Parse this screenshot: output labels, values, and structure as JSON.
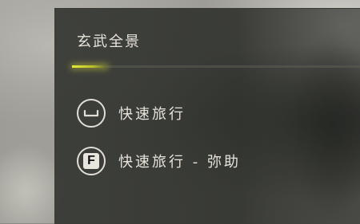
{
  "panel": {
    "title": "玄武全景",
    "progress": 0.12
  },
  "actions": [
    {
      "key": "space",
      "key_label": "",
      "label": "快速旅行"
    },
    {
      "key": "F",
      "key_label": "F",
      "label": "快速旅行 - 弥助"
    }
  ],
  "colors": {
    "accent": "#e8ea3a",
    "text": "#e6e3da",
    "panel_bg": "#343632"
  }
}
